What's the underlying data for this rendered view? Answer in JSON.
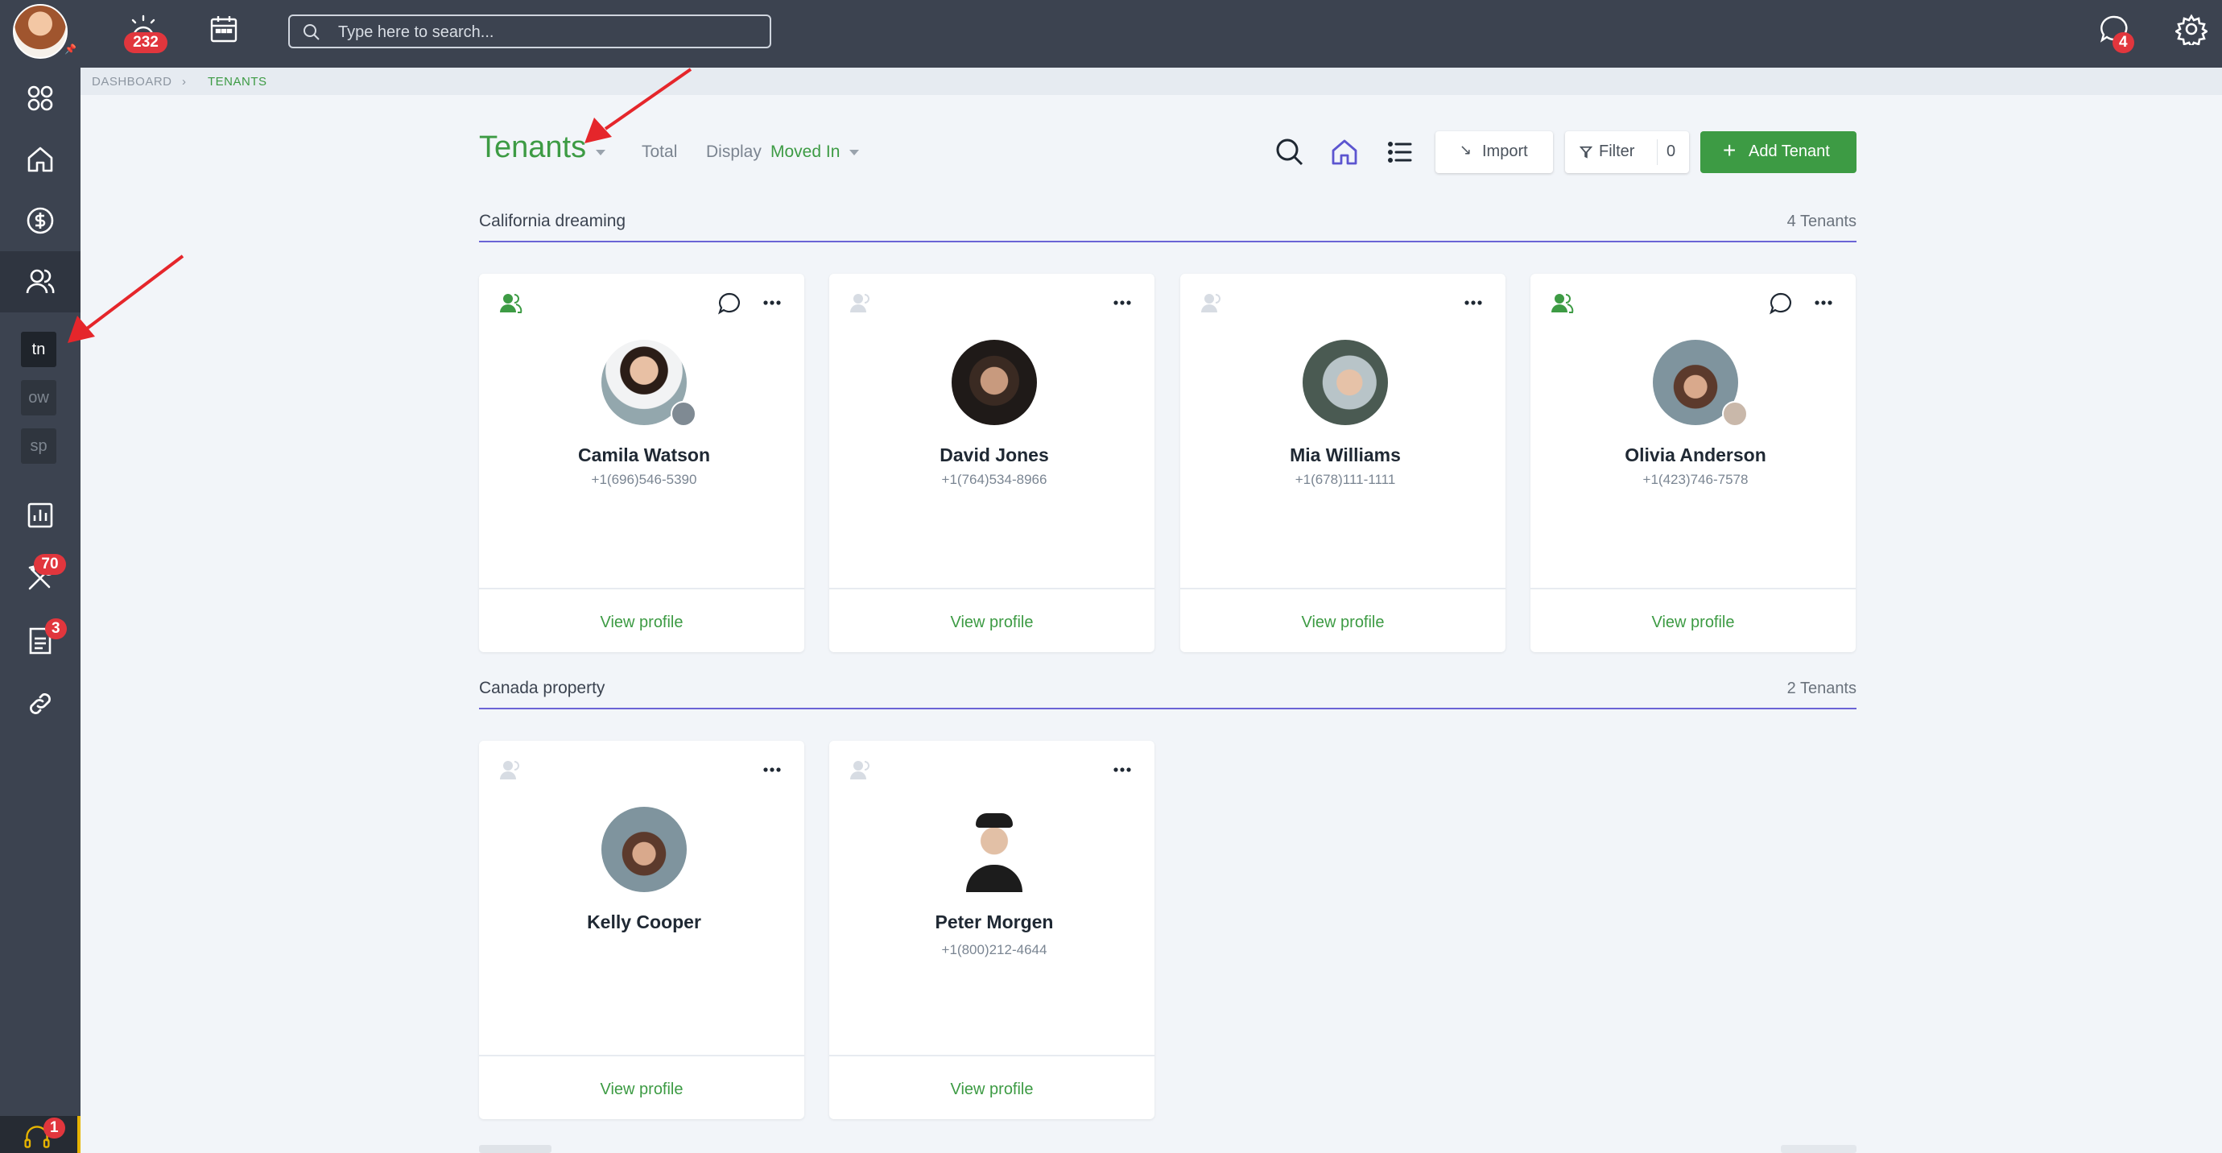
{
  "topbar": {
    "alarm_badge": "232",
    "chat_badge": "4",
    "search_placeholder": "Type here to search..."
  },
  "sidebar": {
    "items": [
      "dashboard",
      "home",
      "accounting",
      "people",
      "reports",
      "maintenance",
      "documents",
      "links"
    ],
    "sub_chips": [
      "tn",
      "ow",
      "sp"
    ],
    "maintenance_badge": "70",
    "documents_badge": "3",
    "support_badge": "1"
  },
  "breadcrumb": {
    "root": "DASHBOARD",
    "current": "TENANTS"
  },
  "header": {
    "title": "Tenants",
    "total_label": "Total",
    "display_label": "Display",
    "display_value": "Moved In",
    "import_label": "Import",
    "filter_label": "Filter",
    "filter_count": "0",
    "add_label": "Add Tenant"
  },
  "sections": [
    {
      "title": "California dreaming",
      "count": "4 Tenants",
      "tenants": [
        {
          "name": "Camila Watson",
          "phone": "+1(696)546-5390",
          "link": "View profile",
          "active": true,
          "chat": true
        },
        {
          "name": "David Jones",
          "phone": "+1(764)534-8966",
          "link": "View profile",
          "active": false,
          "chat": false
        },
        {
          "name": "Mia Williams",
          "phone": "+1(678)111-1111",
          "link": "View profile",
          "active": false,
          "chat": false
        },
        {
          "name": "Olivia Anderson",
          "phone": "+1(423)746-7578",
          "link": "View profile",
          "active": true,
          "chat": true
        }
      ]
    },
    {
      "title": "Canada property",
      "count": "2 Tenants",
      "tenants": [
        {
          "name": "Kelly Cooper",
          "phone": "",
          "link": "View profile",
          "active": false,
          "chat": false
        },
        {
          "name": "Peter Morgen",
          "phone": "+1(800)212-4644",
          "link": "View profile",
          "active": false,
          "chat": false
        }
      ]
    }
  ],
  "colors": {
    "brand_green": "#3d9b44",
    "topbar": "#3c4350",
    "accent_line": "#6b64d6",
    "badge_red": "#e1363d",
    "annotation_arrow": "#e5262b"
  }
}
